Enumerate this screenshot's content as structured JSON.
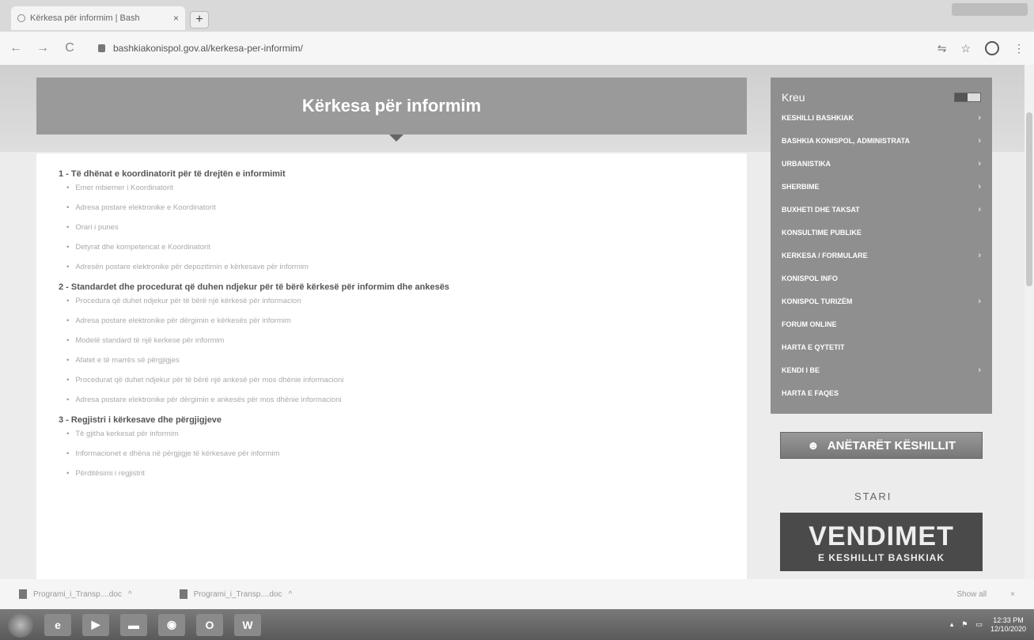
{
  "browser": {
    "tab_title": "Kërkesa për informim | Bash",
    "tab_close": "×",
    "new_tab": "+",
    "back": "←",
    "forward": "→",
    "reload": "C",
    "url": "bashkiakonispol.gov.al/kerkesa-per-informim/",
    "star": "☆"
  },
  "page": {
    "title": "Kërkesa për informim",
    "sections": [
      {
        "heading": "1 - Të dhënat e koordinatorit për të drejtën e informimit",
        "items": [
          "Emer mbiemer i Koordinatorit",
          "Adresa postare elektronike e Koordinatorit",
          "Orari i punes",
          "Detyrat dhe kompetencat e Koordinatorit",
          "Adresën postare elektronike për depozitimin e kërkesave për informim"
        ]
      },
      {
        "heading": "2 - Standardet dhe procedurat që duhen ndjekur për të bërë kërkesë për informim dhe ankesës",
        "items": [
          "Procedura që duhet ndjekur për të bërë një kërkesë për informacion",
          "Adresa postare elektronike për dërgimin e kërkesës për informim",
          "Modelë standard të një kerkese për informim",
          "Afatet e të marrës së përgjigjes",
          "Procedurat që duhet ndjekur për të bërë një ankesë për mos dhënie informacioni",
          "Adresa postare elektronike për dërgimin e ankesës për mos dhënie informacioni"
        ]
      },
      {
        "heading": "3 - Regjistri i kërkesave dhe përgjigjeve",
        "items": [
          "Të gjitha kerkesat për informim",
          "Informacionet e dhëna në përgjigje të kërkesave për informim",
          "Përditësimi i regjistrit"
        ]
      }
    ]
  },
  "sidebar": {
    "menu_title": "Kreu",
    "items": [
      {
        "label": "KESHILLI BASHKIAK",
        "has_sub": true
      },
      {
        "label": "BASHKIA KONISPOL, ADMINISTRATA",
        "has_sub": true
      },
      {
        "label": "URBANISTIKA",
        "has_sub": true
      },
      {
        "label": "SHERBIME",
        "has_sub": true
      },
      {
        "label": "BUXHETI DHE TAKSAT",
        "has_sub": true
      },
      {
        "label": "KONSULTIME PUBLIKE",
        "has_sub": false
      },
      {
        "label": "KERKESA / FORMULARE",
        "has_sub": true
      },
      {
        "label": "KONISPOL INFO",
        "has_sub": false
      },
      {
        "label": "KONISPOL TURIZËM",
        "has_sub": true
      },
      {
        "label": "FORUM ONLINE",
        "has_sub": false
      },
      {
        "label": "HARTA E QYTETIT",
        "has_sub": false
      },
      {
        "label": "KENDI I BE",
        "has_sub": true
      },
      {
        "label": "HARTA E FAQES",
        "has_sub": false
      }
    ],
    "chevron": "›",
    "banner_members": "ANËTARËT KËSHILLIT",
    "stari_logo": "STARI",
    "vendimet_big": "VENDIMET",
    "vendimet_small": "E KESHILLIT BASHKIAK"
  },
  "downloads": {
    "files": [
      "Programi_i_Transp....doc",
      "Programi_i_Transp....doc"
    ],
    "caret": "^",
    "show_all": "Show all",
    "close": "×"
  },
  "taskbar": {
    "time": "12:33 PM",
    "date": "12/10/2020",
    "outlook_label": "O",
    "word_label": "W"
  }
}
